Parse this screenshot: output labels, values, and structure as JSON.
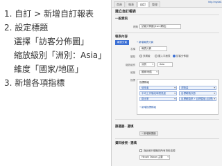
{
  "instructions": {
    "steps": [
      "1. 自訂 > 新增自訂報表",
      "2. 設定標題",
      "選擇「訪客分佈圖」",
      "縮放級別「洲別：Asia」",
      "維度「國家/地區」",
      "3. 新增各項指標"
    ]
  },
  "app": {
    "tabs": [
      "首頁",
      "報表",
      "自訂",
      "管理"
    ],
    "active_tab": "自訂",
    "url": "http://mydall.my-..."
  },
  "form": {
    "page_title": "建立自訂報表",
    "general_section": "一般資訊",
    "title_label": "標題",
    "title_value": "訪客分佈圖 [from 網站]",
    "content_section": "報表內容",
    "report_tab_label": "報表分頁",
    "add_tab_link": "+ 新增報表分頁",
    "name_label": "名稱",
    "name_value": "報表分頁",
    "type_label": "類型",
    "type_options": [
      "多層級",
      "載入平面表",
      "訪客分佈圖"
    ],
    "zoom_label": "縮放級別",
    "zoom_value": "洲別",
    "zoom_region": "Asia",
    "dimension_label": "維度",
    "dimension_value": "國家/地區",
    "metric_label": "指標",
    "metric_group": "指標群組",
    "metrics": [
      "使用者",
      "瀏覽量",
      "平均工作階段時間長度",
      "目標轉換次數",
      "跳出率",
      "目標轉換率 + 目標價值 (目標)"
    ],
    "add_metric_link": "+ 新增指標群組",
    "filter_section": "篩選器 - 選填",
    "filter_button": "+ 新增篩選器",
    "view_section": "資料檢視 - 選填",
    "view_checkbox_label": "與此帳戶關聯的所有資料檢視",
    "view_select": "Hiroshi Taiwan 主要"
  }
}
